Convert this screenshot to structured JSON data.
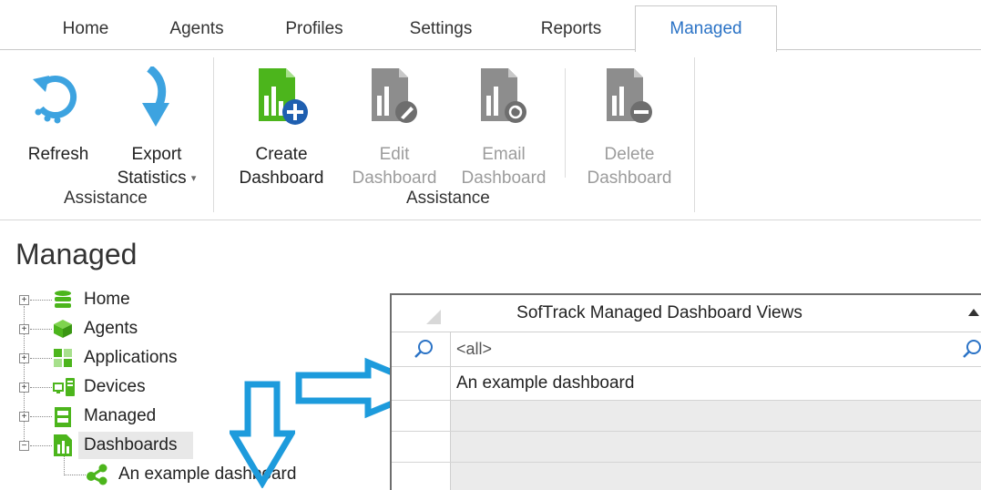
{
  "tabs": [
    {
      "label": "Home",
      "active": false
    },
    {
      "label": "Agents",
      "active": false
    },
    {
      "label": "Profiles",
      "active": false
    },
    {
      "label": "Settings",
      "active": false
    },
    {
      "label": "Reports",
      "active": false
    },
    {
      "label": "Managed",
      "active": true
    }
  ],
  "ribbon": {
    "refresh": {
      "label": "Refresh",
      "icon": "refresh-icon"
    },
    "export": {
      "label_line1": "Export",
      "label_line2": "Statistics",
      "icon": "download-arrow-icon",
      "has_dropdown": true
    },
    "group1_label": "Assistance",
    "create": {
      "label_line1": "Create",
      "label_line2": "Dashboard",
      "icon": "dashboard-add-icon",
      "enabled": true
    },
    "edit": {
      "label_line1": "Edit",
      "label_line2": "Dashboard",
      "icon": "dashboard-edit-icon",
      "enabled": false
    },
    "email": {
      "label_line1": "Email",
      "label_line2": "Dashboard",
      "icon": "dashboard-email-icon",
      "enabled": false
    },
    "delete": {
      "label_line1": "Delete",
      "label_line2": "Dashboard",
      "icon": "dashboard-delete-icon",
      "enabled": false
    },
    "group2_label": "Assistance"
  },
  "panel": {
    "title": "Managed",
    "tree": [
      {
        "label": "Home",
        "icon": "database-icon",
        "expander": "+"
      },
      {
        "label": "Agents",
        "icon": "cube-icon",
        "expander": "+"
      },
      {
        "label": "Applications",
        "icon": "applications-icon",
        "expander": "+"
      },
      {
        "label": "Devices",
        "icon": "devices-icon",
        "expander": "+"
      },
      {
        "label": "Managed",
        "icon": "managed-icon",
        "expander": "+"
      },
      {
        "label": "Dashboards",
        "icon": "dashboard-icon",
        "expander": "−",
        "selected": true
      },
      {
        "label": "An example dashboard",
        "icon": "share-icon",
        "child": true
      }
    ]
  },
  "grid": {
    "column_header": "SofTrack Managed Dashboard Views",
    "filter_value": "<all>",
    "rows": [
      "An example dashboard",
      "",
      "",
      ""
    ]
  },
  "colors": {
    "accent": "#2b73c6",
    "icon_green": "#4cb51c",
    "icon_blue": "#3da3e0",
    "callout_arrow": "#1d9bdc",
    "disabled_icon": "#8d8d8d"
  }
}
